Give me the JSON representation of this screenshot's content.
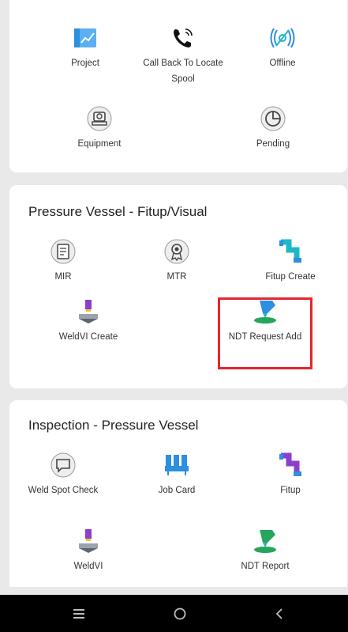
{
  "section_top": {
    "tiles": [
      {
        "label": "Project",
        "icon": "project-chart-icon"
      },
      {
        "label": "Call Back To Locate Spool",
        "icon": "phone-call-icon"
      },
      {
        "label": "Offline",
        "icon": "offline-wave-icon"
      },
      {
        "label": "Equipment",
        "icon": "equipment-icon"
      },
      {
        "label": "Pending",
        "icon": "pie-chart-icon"
      }
    ]
  },
  "section_fitup": {
    "title": "Pressure Vessel - Fitup/Visual",
    "tiles": [
      {
        "label": "MIR",
        "icon": "document-icon"
      },
      {
        "label": "MTR",
        "icon": "certificate-badge-icon"
      },
      {
        "label": "Fitup Create",
        "icon": "pipe-fitup-icon"
      },
      {
        "label": "WeldVI Create",
        "icon": "weld-vi-icon"
      },
      {
        "label": "NDT Request Add",
        "icon": "ndt-scan-icon"
      }
    ]
  },
  "section_inspection": {
    "title": "Inspection - Pressure Vessel",
    "tiles": [
      {
        "label": "Weld Spot Check",
        "icon": "chat-spot-icon"
      },
      {
        "label": "Job Card",
        "icon": "job-card-icon"
      },
      {
        "label": "Fitup",
        "icon": "pipe-fitup-icon"
      },
      {
        "label": "WeldVI",
        "icon": "weld-vi-icon"
      },
      {
        "label": "NDT Report",
        "icon": "ndt-report-icon"
      }
    ]
  },
  "colors": {
    "highlight": "#e5262d",
    "blue": "#2c8fe0",
    "teal": "#1fb6c9",
    "purple": "#8a3fd1",
    "green": "#26a65b"
  }
}
